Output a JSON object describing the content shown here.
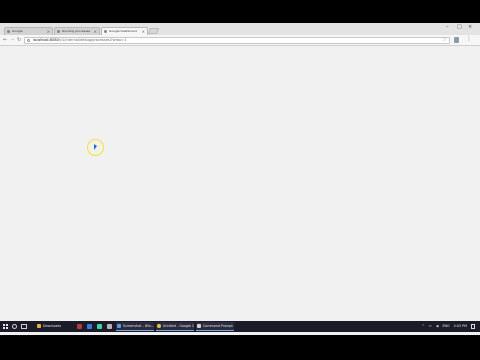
{
  "browser": {
    "tabs": [
      {
        "label": "Google",
        "active": false
      },
      {
        "label": "Running processes",
        "active": false
      },
      {
        "label": "Google Dashboard",
        "active": true
      }
    ],
    "url_host": "localhost:8080",
    "url_path": "/v1/internal/debug/processes/?wrap=1"
  },
  "taskbar": {
    "pinned_label": "Downloads",
    "tasks": [
      {
        "label": "Screenshot - Win..."
      },
      {
        "label": "Untitled - Google Ch..."
      },
      {
        "label": "Command Prompt - "
      }
    ],
    "tray_lang": "ENG",
    "tray_time": "4:03 PM"
  },
  "colors": {
    "page_background": "#f1f1f1",
    "taskbar": "#1b1b2a",
    "cursor_highlight": "#f0e04a"
  }
}
